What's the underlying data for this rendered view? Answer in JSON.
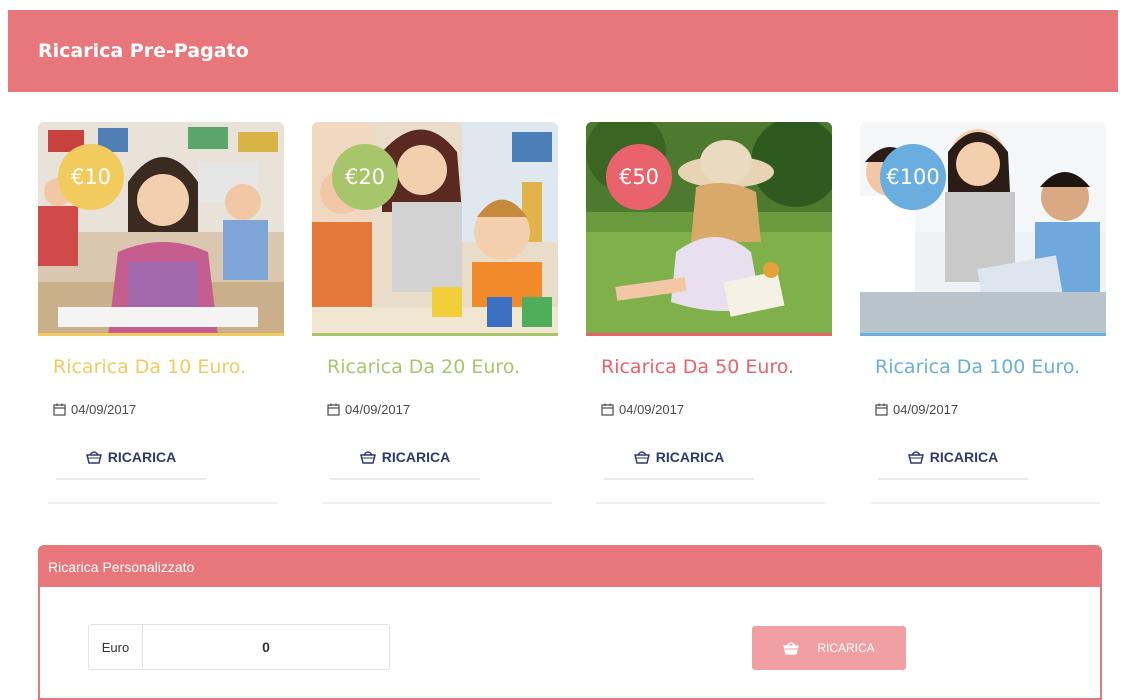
{
  "header": {
    "title": "Ricarica Pre-Pagato"
  },
  "cards": [
    {
      "badge": "€10",
      "title": "Ricarica Da 10 Euro.",
      "date": "04/09/2017",
      "button": "RICARICA",
      "color": "#f2cb5e"
    },
    {
      "badge": "€20",
      "title": "Ricarica Da 20 Euro.",
      "date": "04/09/2017",
      "button": "RICARICA",
      "color": "#a7c66b"
    },
    {
      "badge": "€50",
      "title": "Ricarica Da 50 Euro.",
      "date": "04/09/2017",
      "button": "RICARICA",
      "color": "#e8636b"
    },
    {
      "badge": "€100",
      "title": "Ricarica Da 100 Euro.",
      "date": "04/09/2017",
      "button": "RICARICA",
      "color": "#6aaee0"
    }
  ],
  "custom": {
    "title": "Ricarica Personalizzato",
    "currency_label": "Euro",
    "amount_value": "0",
    "button": "RICARICA"
  },
  "colors": {
    "header_bg": "#e8777b",
    "button_text": "#2f3b6e",
    "custom_button_bg": "#f0a0a3"
  },
  "icons": {
    "date": "calendar-icon",
    "button": "basket-icon"
  }
}
